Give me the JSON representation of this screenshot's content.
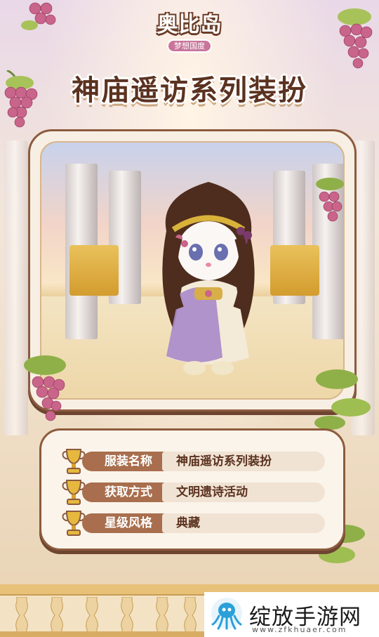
{
  "logo": {
    "main": "奥比岛",
    "sub": "梦想国度"
  },
  "title": "神庙遥访系列装扮",
  "details": [
    {
      "label": "服装名称",
      "value": "神庙遥访系列装扮"
    },
    {
      "label": "获取方式",
      "value": "文明遗诗活动"
    },
    {
      "label": "星级风格",
      "value": "典藏"
    }
  ],
  "watermark": {
    "text": "绽放手游网",
    "url": "www.zfkhuaer.com"
  },
  "icons": {
    "trophy": "trophy-icon",
    "grapes": "grape-cluster-icon",
    "watermark_logo": "octopus-logo-icon"
  },
  "colors": {
    "title": "#5b3220",
    "label_bg": "#a86e4d",
    "value_bg": "#f0e3d4",
    "frame_border": "#8c5b3e",
    "grape": "#c9648a"
  }
}
